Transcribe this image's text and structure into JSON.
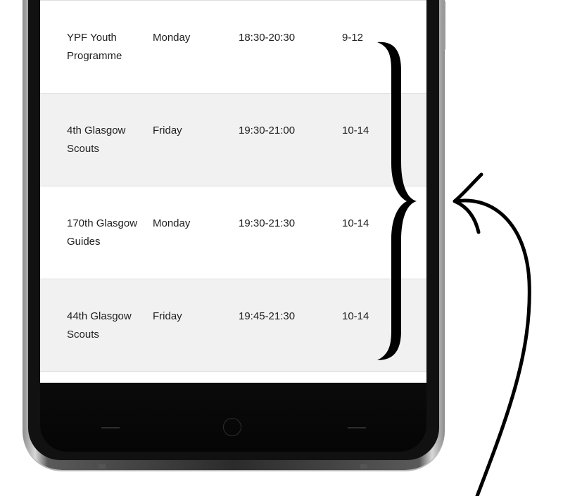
{
  "table": {
    "rows": [
      {
        "name": "YPF Youth Programme",
        "day": "Monday",
        "time": "18:30-20:30",
        "age": "9-12"
      },
      {
        "name": "4th Glasgow Scouts",
        "day": "Friday",
        "time": "19:30-21:00",
        "age": "10-14"
      },
      {
        "name": "170th Glasgow Guides",
        "day": "Monday",
        "time": "19:30-21:30",
        "age": "10-14"
      },
      {
        "name": "44th Glasgow Scouts",
        "day": "Friday",
        "time": "19:45-21:30",
        "age": "10-14"
      }
    ]
  },
  "colors": {
    "row_odd": "#ffffff",
    "row_even": "#f1f1f1",
    "text": "#1f1f1f",
    "annotation": "#000000"
  },
  "icons": {
    "home": "home-button-icon",
    "back": "back-nav-icon",
    "recent": "recent-apps-icon",
    "brace": "curly-brace-icon",
    "arrow": "curved-arrow-icon"
  }
}
